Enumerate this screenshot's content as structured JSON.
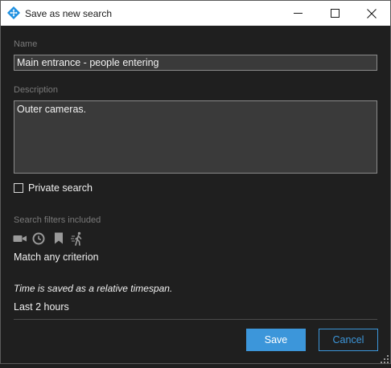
{
  "window": {
    "title": "Save as new search",
    "controls": [
      "minimize-icon",
      "maximize-icon",
      "close-icon"
    ]
  },
  "form": {
    "name_label": "Name",
    "name_value": "Main entrance - people entering",
    "description_label": "Description",
    "description_value": "Outer cameras.",
    "private_label": "Private search",
    "private_checked": false,
    "filters_label": "Search filters included",
    "filter_icons": [
      "camera-icon",
      "clock-icon",
      "bookmark-icon",
      "person-walking-icon"
    ],
    "match_text": "Match any criterion",
    "time_note": "Time is saved as a relative timespan.",
    "time_value": "Last 2 hours"
  },
  "buttons": {
    "save": "Save",
    "cancel": "Cancel"
  },
  "colors": {
    "accent": "#3c96da",
    "background": "#1f1f1f",
    "field": "#3a3a3a"
  }
}
